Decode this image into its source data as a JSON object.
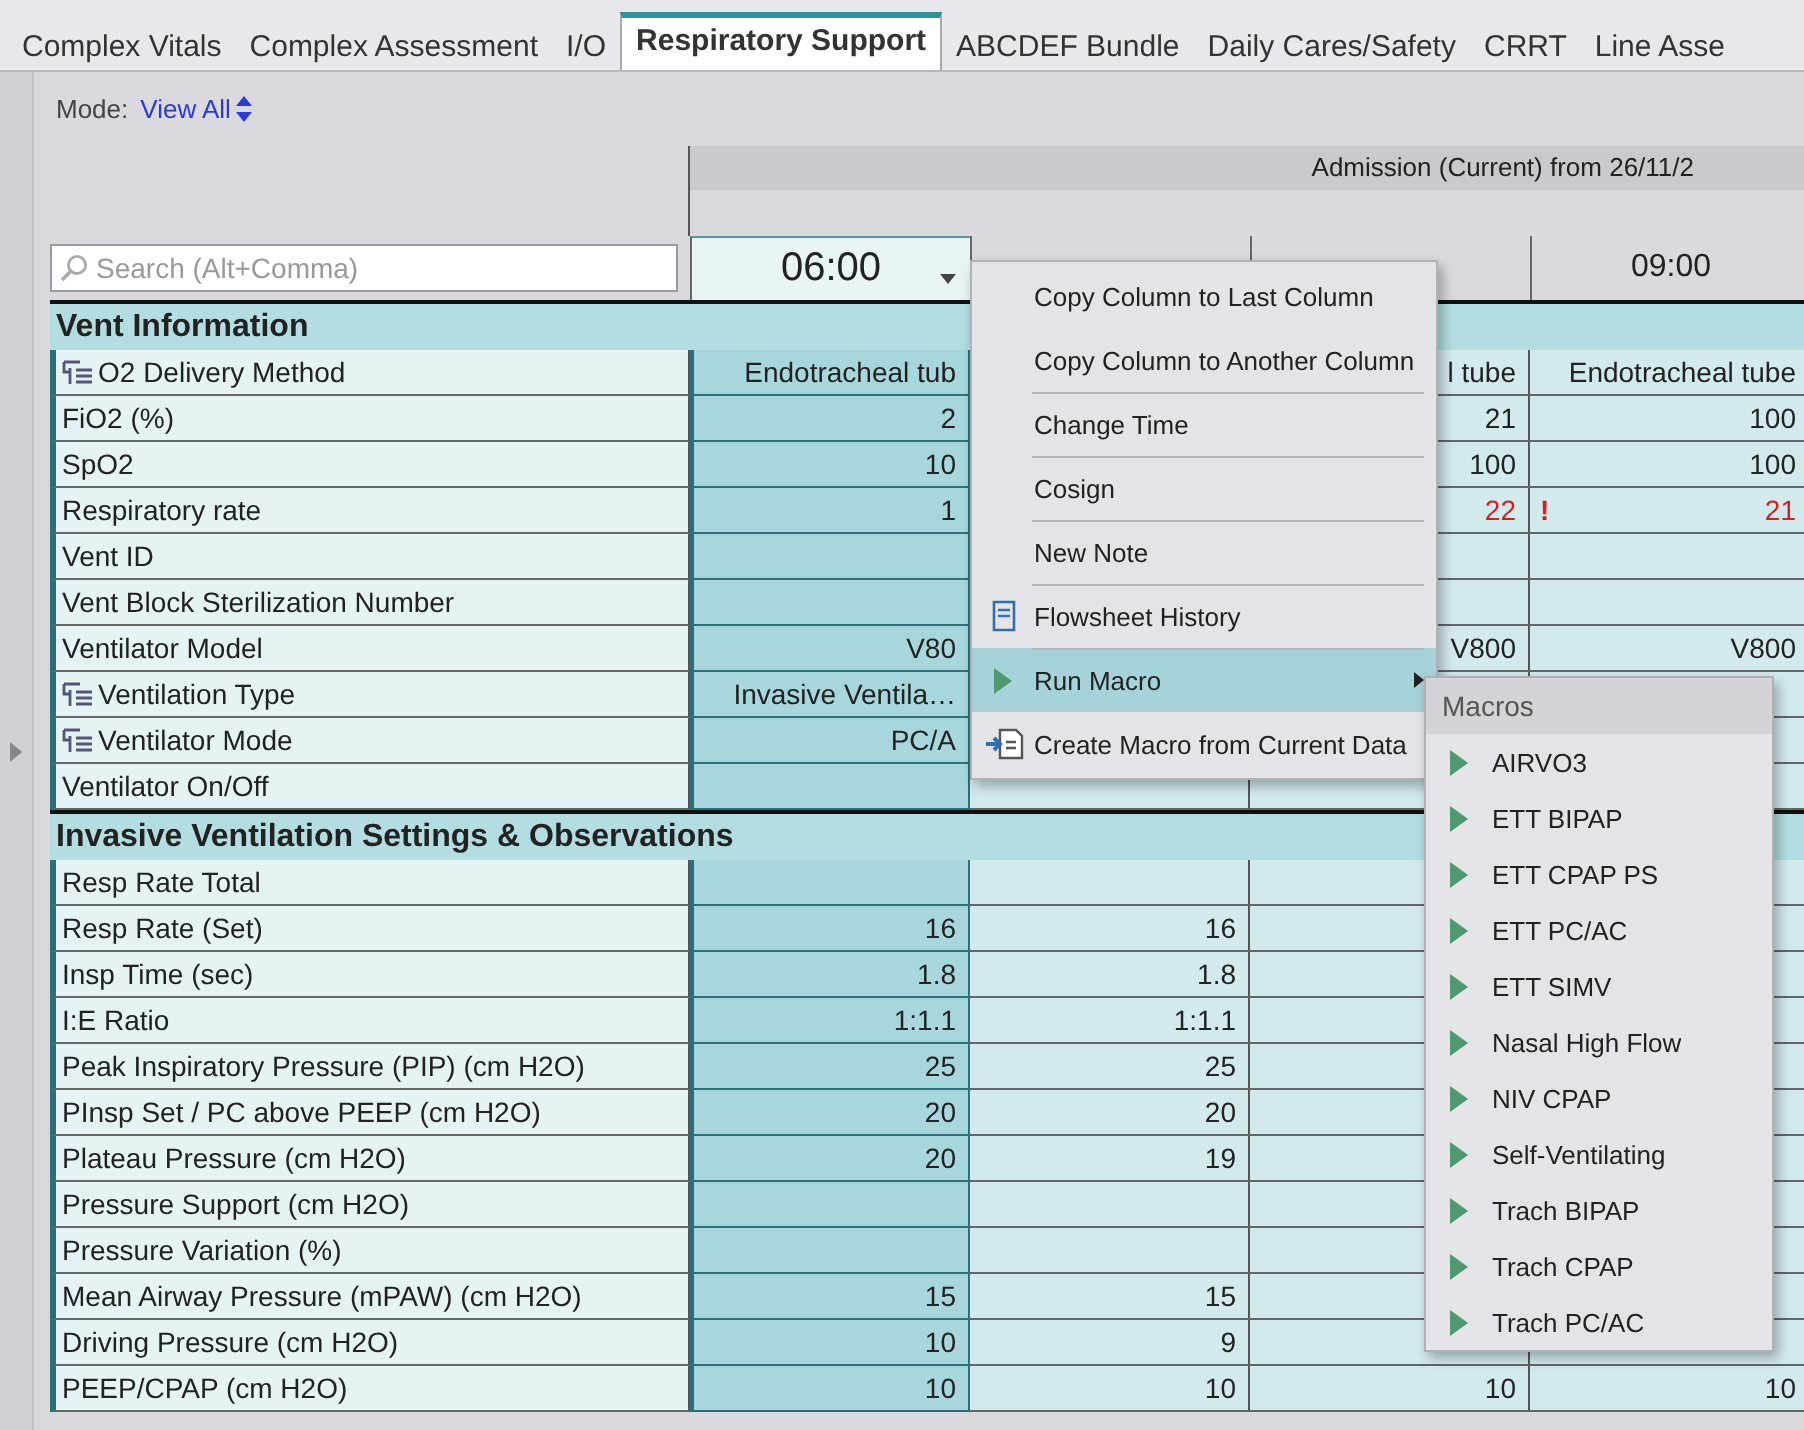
{
  "tabs": [
    {
      "label": "Complex Vitals",
      "selected": false
    },
    {
      "label": "Complex Assessment",
      "selected": false
    },
    {
      "label": "I/O",
      "selected": false
    },
    {
      "label": "Respiratory Support",
      "selected": true
    },
    {
      "label": "ABCDEF Bundle",
      "selected": false
    },
    {
      "label": "Daily Cares/Safety",
      "selected": false
    },
    {
      "label": "CRRT",
      "selected": false
    },
    {
      "label": "Line Asse",
      "selected": false
    }
  ],
  "mode": {
    "label": "Mode:",
    "value": "View All"
  },
  "encounter_band": "Admission (Current) from 26/11/2",
  "search": {
    "placeholder": "Search (Alt+Comma)"
  },
  "columns": [
    {
      "time": "06:00",
      "selected": true
    },
    {
      "selected": false
    },
    {
      "selected": false
    },
    {
      "time": "09:00",
      "selected": false
    }
  ],
  "sections": [
    {
      "title": "Vent Information",
      "rows": [
        {
          "label": "O2 Delivery Method",
          "list": true,
          "cells": [
            "Endotracheal tub",
            null,
            "l tube",
            "Endotracheal tube"
          ]
        },
        {
          "label": "FiO2 (%)",
          "list": false,
          "cells": [
            "2",
            null,
            "21",
            "100"
          ]
        },
        {
          "label": "SpO2",
          "list": false,
          "cells": [
            "10",
            null,
            "100",
            "100"
          ]
        },
        {
          "label": "Respiratory rate",
          "list": false,
          "cells": [
            "1",
            null,
            {
              "text": "22",
              "abnormal": true
            },
            {
              "text": "21",
              "abnormal": true,
              "flag": "!"
            }
          ]
        },
        {
          "label": "Vent ID",
          "list": false,
          "cells": [
            null,
            null,
            null,
            null
          ]
        },
        {
          "label": "Vent Block Sterilization Number",
          "list": false,
          "cells": [
            null,
            null,
            null,
            null
          ]
        },
        {
          "label": "Ventilator Model",
          "list": false,
          "cells": [
            "V80",
            null,
            "V800",
            "V800"
          ]
        },
        {
          "label": "Ventilation Type",
          "list": true,
          "cells": [
            "Invasive Ventila…",
            null,
            null,
            null
          ]
        },
        {
          "label": "Ventilator Mode",
          "list": true,
          "cells": [
            "PC/A",
            null,
            null,
            null
          ]
        },
        {
          "label": "Ventilator On/Off",
          "list": false,
          "cells": [
            null,
            null,
            null,
            null
          ]
        }
      ]
    },
    {
      "title": "Invasive Ventilation Settings & Observations",
      "rows": [
        {
          "label": "Resp Rate Total",
          "list": false,
          "cells": [
            null,
            null,
            null,
            null
          ]
        },
        {
          "label": "Resp Rate (Set)",
          "list": false,
          "cells": [
            "16",
            "16",
            null,
            null
          ]
        },
        {
          "label": "Insp Time (sec)",
          "list": false,
          "cells": [
            "1.8",
            "1.8",
            null,
            null
          ]
        },
        {
          "label": "I:E Ratio",
          "list": false,
          "cells": [
            "1:1.1",
            "1:1.1",
            null,
            null
          ]
        },
        {
          "label": "Peak Inspiratory Pressure (PIP) (cm H2O)",
          "list": false,
          "cells": [
            "25",
            "25",
            null,
            null
          ]
        },
        {
          "label": "PInsp Set / PC above PEEP (cm H2O)",
          "list": false,
          "cells": [
            "20",
            "20",
            null,
            null
          ]
        },
        {
          "label": "Plateau Pressure (cm H2O)",
          "list": false,
          "cells": [
            "20",
            "19",
            null,
            null
          ]
        },
        {
          "label": "Pressure Support (cm H2O)",
          "list": false,
          "cells": [
            null,
            null,
            null,
            null
          ]
        },
        {
          "label": "Pressure Variation (%)",
          "list": false,
          "cells": [
            null,
            null,
            null,
            null
          ]
        },
        {
          "label": "Mean Airway Pressure (mPAW) (cm H2O)",
          "list": false,
          "cells": [
            "15",
            "15",
            null,
            null
          ]
        },
        {
          "label": "Driving Pressure (cm H2O)",
          "list": false,
          "cells": [
            "10",
            "9",
            null,
            null
          ]
        },
        {
          "label": "PEEP/CPAP (cm H2O)",
          "list": false,
          "cells": [
            "10",
            "10",
            "10",
            "10"
          ]
        }
      ]
    }
  ],
  "context_menu": {
    "items": [
      {
        "label": "Copy Column to Last Column",
        "kind": "plain",
        "separator": false,
        "selected": false,
        "submenu": false
      },
      {
        "label": "Copy Column to Another Column",
        "kind": "plain",
        "separator": false,
        "selected": false,
        "submenu": false
      },
      {
        "label": "Change Time",
        "kind": "plain",
        "separator": true,
        "selected": false,
        "submenu": false
      },
      {
        "label": "Cosign",
        "kind": "plain",
        "separator": true,
        "selected": false,
        "submenu": false
      },
      {
        "label": "New Note",
        "kind": "plain",
        "separator": true,
        "selected": false,
        "submenu": false
      },
      {
        "label": "Flowsheet History",
        "kind": "history",
        "separator": true,
        "selected": false,
        "submenu": false
      },
      {
        "label": "Run Macro",
        "kind": "macro",
        "separator": true,
        "selected": true,
        "submenu": true
      },
      {
        "label": "Create Macro from Current Data",
        "kind": "create",
        "separator": false,
        "selected": false,
        "submenu": false
      }
    ]
  },
  "macro_menu": {
    "title": "Macros",
    "items": [
      "AIRVO3",
      "ETT BIPAP",
      "ETT CPAP PS",
      "ETT PC/AC",
      "ETT SIMV",
      "Nasal High Flow",
      "NIV CPAP",
      "Self-Ventilating",
      "Trach BIPAP",
      "Trach CPAP",
      "Trach PC/AC"
    ]
  }
}
